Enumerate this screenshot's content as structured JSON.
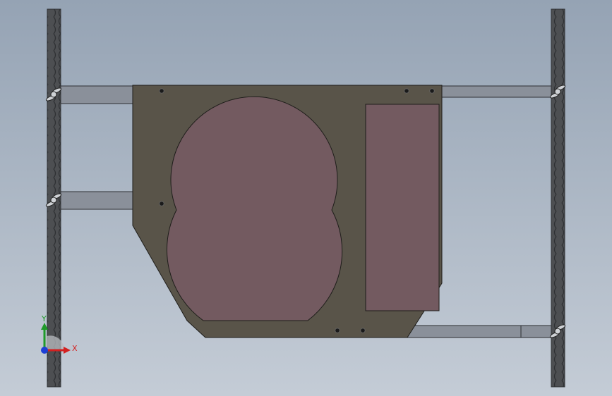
{
  "viewport": {
    "background_top": "#95a3b4",
    "background_bottom": "#c4ccd6"
  },
  "colors": {
    "rail": "#4d4f52",
    "rail_link": "#2f3134",
    "bar": "#8a909a",
    "bar_edge": "#2d2f33",
    "plate": "#595449",
    "plate_edge": "#1e1d1a",
    "cutout": "#735a60",
    "hole": "#1a1a1a",
    "wingnut": "#cfd2d6",
    "axis_x": "#d32020",
    "axis_y": "#1f9a2a",
    "axis_z": "#1d3fd6"
  },
  "components": {
    "left_rail": "vertical-rail-left",
    "right_rail": "vertical-rail-right",
    "plate": "mounting-plate",
    "lobe_cutout": "double-lobe-cutout",
    "rect_cutout": "rectangular-cutout"
  },
  "triad": {
    "x_label": "X",
    "y_label": "Y"
  }
}
